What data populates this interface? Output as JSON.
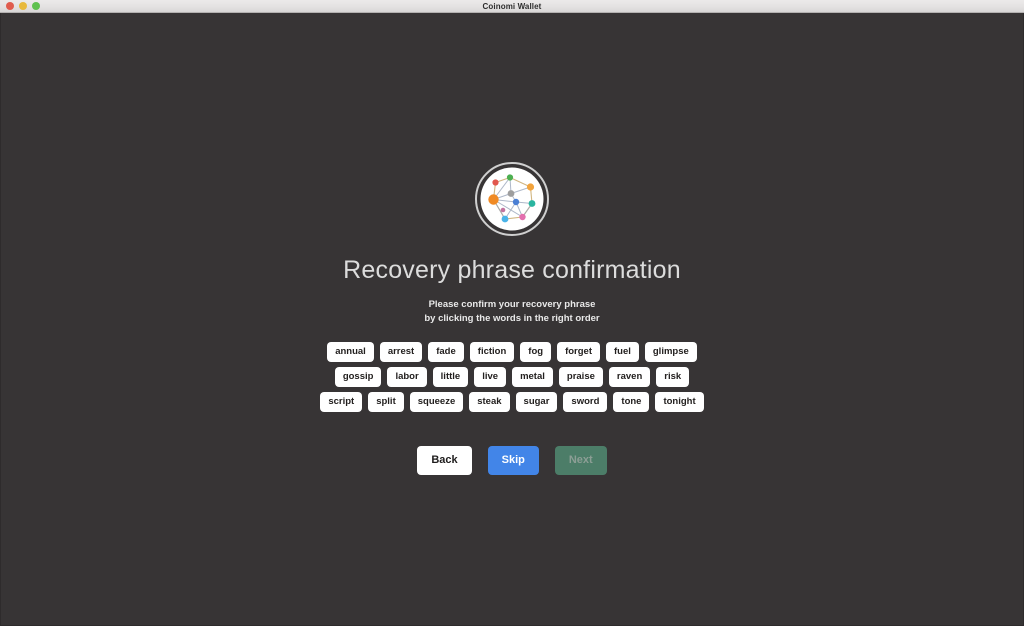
{
  "window": {
    "title": "Coinomi Wallet",
    "traffic_lights": [
      {
        "name": "close",
        "color": "#e05c4e"
      },
      {
        "name": "minimize",
        "color": "#e8b93c"
      },
      {
        "name": "maximize",
        "color": "#5fc14f"
      }
    ]
  },
  "logo": {
    "icon": "coinomi-network-logo"
  },
  "page": {
    "title": "Recovery phrase confirmation",
    "subtitle_line1": "Please confirm your recovery phrase",
    "subtitle_line2": "by clicking the words in the right order"
  },
  "word_rows": [
    [
      "annual",
      "arrest",
      "fade",
      "fiction",
      "fog",
      "forget",
      "fuel",
      "glimpse"
    ],
    [
      "gossip",
      "labor",
      "little",
      "live",
      "metal",
      "praise",
      "raven",
      "risk"
    ],
    [
      "script",
      "split",
      "squeeze",
      "steak",
      "sugar",
      "sword",
      "tone",
      "tonight"
    ]
  ],
  "buttons": {
    "back": "Back",
    "skip": "Skip",
    "next": "Next"
  },
  "colors": {
    "background": "#373435",
    "titlebar": "#e8e6e6",
    "chip_background": "#ffffff",
    "skip_background": "#4285e8",
    "next_background": "#4c7d68",
    "next_text": "#8c9e95",
    "title_text": "#dcdcdc"
  }
}
